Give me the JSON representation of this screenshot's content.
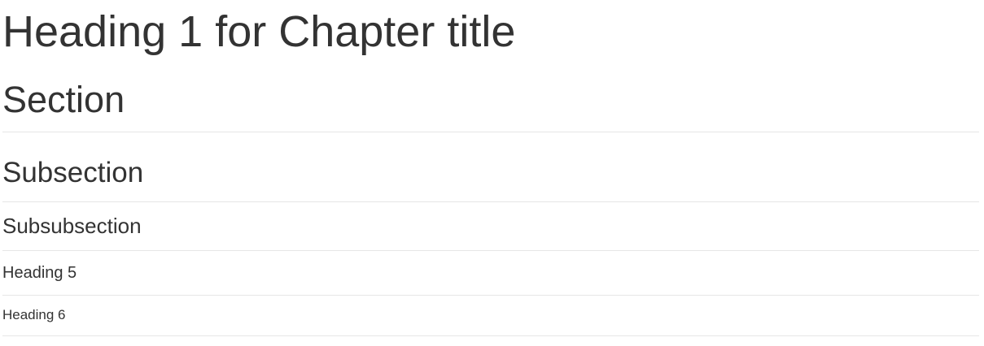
{
  "headings": {
    "h1": "Heading 1 for Chapter title",
    "h2": "Section",
    "h3": "Subsection",
    "h4": "Subsubsection",
    "h5": "Heading 5",
    "h6": "Heading 6"
  },
  "colors": {
    "text": "#333333",
    "rule": "#e6e6e6"
  }
}
